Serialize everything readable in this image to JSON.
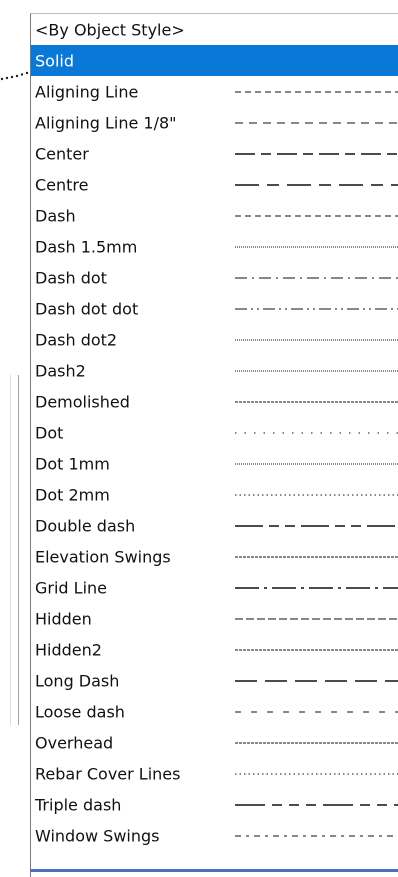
{
  "line_patterns": [
    {
      "label": "<By Object Style>",
      "pattern": "none",
      "selected": false
    },
    {
      "label": "Solid",
      "pattern": "none",
      "selected": true
    },
    {
      "label": "Aligning Line",
      "pattern": "dash-medium",
      "selected": false
    },
    {
      "label": "Aligning Line 1/8\"",
      "pattern": "dash-wide",
      "selected": false
    },
    {
      "label": "Center",
      "pattern": "center",
      "selected": false
    },
    {
      "label": "Centre",
      "pattern": "centre",
      "selected": false
    },
    {
      "label": "Dash",
      "pattern": "dash-medium",
      "selected": false
    },
    {
      "label": "Dash 1.5mm",
      "pattern": "dot-fine",
      "selected": false
    },
    {
      "label": "Dash dot",
      "pattern": "dash-dot",
      "selected": false
    },
    {
      "label": "Dash dot dot",
      "pattern": "dash-dot-dot",
      "selected": false
    },
    {
      "label": "Dash dot2",
      "pattern": "dot-fine",
      "selected": false
    },
    {
      "label": "Dash2",
      "pattern": "dot-fine",
      "selected": false
    },
    {
      "label": "Demolished",
      "pattern": "dash-tight",
      "selected": false
    },
    {
      "label": "Dot",
      "pattern": "dot-sparse",
      "selected": false
    },
    {
      "label": "Dot 1mm",
      "pattern": "dot-fine",
      "selected": false
    },
    {
      "label": "Dot 2mm",
      "pattern": "dot-medium",
      "selected": false
    },
    {
      "label": "Double dash",
      "pattern": "double-dash",
      "selected": false
    },
    {
      "label": "Elevation Swings",
      "pattern": "dash-tight",
      "selected": false
    },
    {
      "label": "Grid Line",
      "pattern": "grid",
      "selected": false
    },
    {
      "label": "Hidden",
      "pattern": "hidden",
      "selected": false
    },
    {
      "label": "Hidden2",
      "pattern": "dash-tight",
      "selected": false
    },
    {
      "label": "Long Dash",
      "pattern": "long-dash",
      "selected": false
    },
    {
      "label": "Loose dash",
      "pattern": "loose-dash",
      "selected": false
    },
    {
      "label": "Overhead",
      "pattern": "dash-tight",
      "selected": false
    },
    {
      "label": "Rebar Cover Lines",
      "pattern": "dot-medium",
      "selected": false
    },
    {
      "label": "Triple dash",
      "pattern": "triple-dash",
      "selected": false
    },
    {
      "label": "Window Swings",
      "pattern": "window",
      "selected": false
    }
  ],
  "colors": {
    "selection": "#0a78d7",
    "line": "#111111",
    "bottom_border": "#4a73b7"
  }
}
